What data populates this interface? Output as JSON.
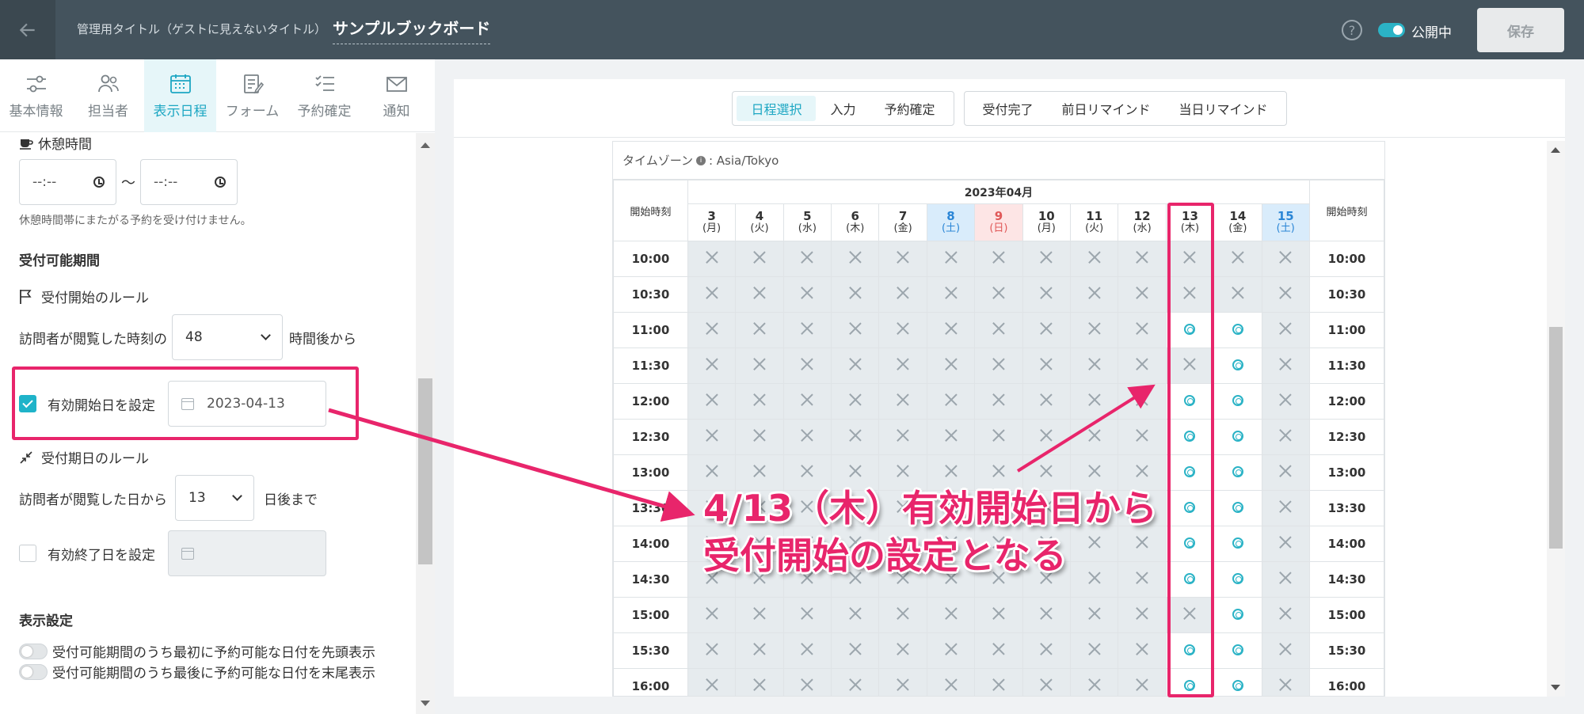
{
  "header": {
    "admin_label": "管理用タイトル（ゲストに見えないタイトル）",
    "title": "サンプルブックボード",
    "help": "?",
    "publish_label": "公開中",
    "save_label": "保存"
  },
  "left_tabs": [
    {
      "label": "基本情報",
      "icon": "sliders-icon"
    },
    {
      "label": "担当者",
      "icon": "users-icon"
    },
    {
      "label": "表示日程",
      "icon": "calendar-icon"
    },
    {
      "label": "フォーム",
      "icon": "form-icon"
    },
    {
      "label": "予約確定",
      "icon": "checklist-icon"
    },
    {
      "label": "通知",
      "icon": "mail-icon"
    }
  ],
  "settings": {
    "break_title": "休憩時間",
    "break_start_placeholder": "--:--",
    "break_tilde": "〜",
    "break_end_placeholder": "--:--",
    "break_note": "休憩時間帯にまたがる予約を受け付けません。",
    "period_title": "受付可能期間",
    "start_rule_title": "受付開始のルール",
    "start_prefix": "訪問者が閲覧した時刻の",
    "start_hours": "48",
    "start_suffix": "時間後から",
    "valid_start_label": "有効開始日を設定",
    "valid_start_date": "2023-04-13",
    "end_rule_title": "受付期日のルール",
    "end_prefix": "訪問者が閲覧した日から",
    "end_days": "13",
    "end_suffix": "日後まで",
    "valid_end_label": "有効終了日を設定",
    "display_title": "表示設定",
    "toggle_first": "受付可能期間のうち最初に予約可能な日付を先頭表示",
    "toggle_last": "受付可能期間のうち最後に予約可能な日付を末尾表示"
  },
  "right_tabs": {
    "group1": [
      "日程選択",
      "入力",
      "予約確定"
    ],
    "group2": [
      "受付完了",
      "前日リマインド",
      "当日リマインド"
    ]
  },
  "calendar": {
    "timezone_label": "タイムゾーン",
    "timezone_value": ": Asia/Tokyo",
    "month": "2023年04月",
    "start_time_header": "開始時刻",
    "days": [
      {
        "d": "3",
        "w": "(月)",
        "type": "weekday"
      },
      {
        "d": "4",
        "w": "(火)",
        "type": "weekday"
      },
      {
        "d": "5",
        "w": "(水)",
        "type": "weekday"
      },
      {
        "d": "6",
        "w": "(木)",
        "type": "weekday"
      },
      {
        "d": "7",
        "w": "(金)",
        "type": "weekday"
      },
      {
        "d": "8",
        "w": "(土)",
        "type": "sat"
      },
      {
        "d": "9",
        "w": "(日)",
        "type": "sun"
      },
      {
        "d": "10",
        "w": "(月)",
        "type": "weekday"
      },
      {
        "d": "11",
        "w": "(火)",
        "type": "weekday"
      },
      {
        "d": "12",
        "w": "(水)",
        "type": "weekday"
      },
      {
        "d": "13",
        "w": "(木)",
        "type": "weekday"
      },
      {
        "d": "14",
        "w": "(金)",
        "type": "weekday"
      },
      {
        "d": "15",
        "w": "(土)",
        "type": "sat"
      }
    ],
    "times": [
      "10:00",
      "10:30",
      "11:00",
      "11:30",
      "12:00",
      "12:30",
      "13:00",
      "13:30",
      "14:00",
      "14:30",
      "15:00",
      "15:30",
      "16:00"
    ],
    "availability": [
      "xxxxxxxxxxxxx",
      "xxxxxxxxxxxxx",
      "xxxxxxxxxxoox",
      "xxxxxxxxxxxox",
      "xxxxxxxxxxoox",
      "xxxxxxxxxxoox",
      "xxxxxxxxxxoox",
      "xxxxxxxxxxoox",
      "xxxxxxxxxxoox",
      "xxxxxxxxxxoox",
      "xxxxxxxxxxxox",
      "xxxxxxxxxxoox",
      "xxxxxxxxxxoox"
    ]
  },
  "annotation": {
    "line1": "4/13（木）有効開始日から",
    "line2": "受付開始の設定となる",
    "color": "#e8256b"
  }
}
